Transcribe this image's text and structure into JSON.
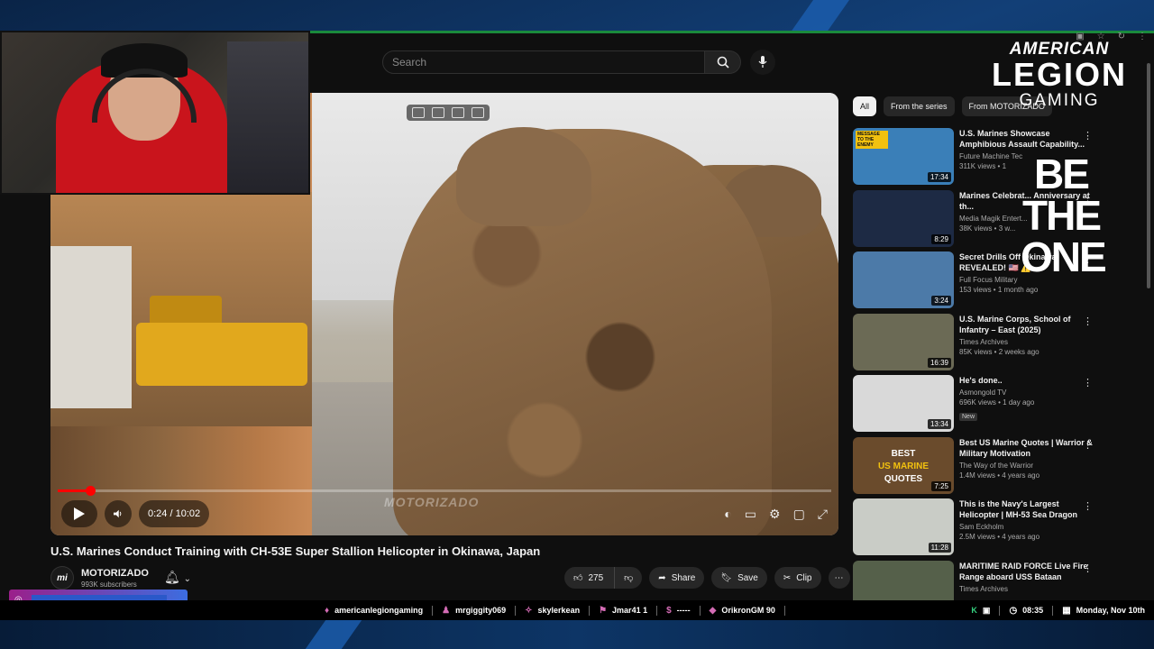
{
  "search": {
    "placeholder": "Search"
  },
  "video": {
    "title": "U.S. Marines Conduct Training with CH-53E Super Stallion Helicopter in Okinawa, Japan",
    "time": "0:24 / 10:02",
    "progress_fraction": 0.0418,
    "watermark": "MOTORIZADO"
  },
  "channel": {
    "name": "MOTORIZADO",
    "subscribers": "993K subscribers",
    "logo": "mi"
  },
  "actions": {
    "likes": "275",
    "share": "Share",
    "save": "Save",
    "clip": "Clip"
  },
  "chips": [
    "All",
    "From the series",
    "From MOTORIZADO"
  ],
  "recommendations": [
    {
      "title": "U.S. Marines Showcase Amphibious Assault Capability...",
      "channel": "Future Machine Tec",
      "meta": "311K views • 1",
      "duration": "17:34",
      "tag": "MESSAGE TO THE ENEMY",
      "thumb_color": "#3a7fb8"
    },
    {
      "title": "Marines Celebrat... Anniversary at th...",
      "channel": "Media Magik Entert...",
      "meta": "38K views • 3 w...",
      "duration": "8:29",
      "thumb_color": "#1d2a44"
    },
    {
      "title": "Secret Drills Off Okinawa REVEALED! 🇺🇸 ⚠️",
      "channel": "Full Focus Military",
      "meta": "153 views • 1 month ago",
      "duration": "3:24",
      "thumb_color": "#4c7aa8"
    },
    {
      "title": "U.S. Marine Corps, School of Infantry – East (2025)",
      "channel": "Times Archives",
      "meta": "85K views • 2 weeks ago",
      "duration": "16:39",
      "thumb_color": "#6b6a55"
    },
    {
      "title": "He's done..",
      "channel": "Asmongold TV",
      "meta": "696K views • 1 day ago",
      "badge": "New",
      "duration": "13:34",
      "thumb_color": "#d9d9d9"
    },
    {
      "title": "Best US Marine Quotes | Warrior & Military Motivation",
      "channel": "The Way of the Warrior",
      "meta": "1.4M views • 4 years ago",
      "duration": "7:25",
      "thumb_line1": "BEST",
      "thumb_line2": "US MARINE",
      "thumb_line3": "QUOTES",
      "thumb_color": "#6a4b2c"
    },
    {
      "title": "This is the Navy's Largest Helicopter | MH-53 Sea Dragon",
      "channel": "Sam Eckholm",
      "meta": "2.5M views • 4 years ago",
      "duration": "11:28",
      "thumb_color": "#c9ccc6"
    },
    {
      "title": "MARITIME RAID FORCE Live Fire Range aboard USS Bataan",
      "channel": "Times Archives",
      "meta": "",
      "duration": "",
      "thumb_color": "#55604a"
    }
  ],
  "branding": {
    "line1": "AMERICAN",
    "line2": "LEGION",
    "line3": "GAMING",
    "slogan": "BE THE ONE"
  },
  "stream_bar": {
    "items": [
      {
        "icon": "community-icon",
        "label": "americanlegiongaming"
      },
      {
        "icon": "follower-icon",
        "label": "mrgiggity069"
      },
      {
        "icon": "subscriber-icon",
        "label": "skylerkean"
      },
      {
        "icon": "raid-icon",
        "label": "Jmar41 1"
      },
      {
        "icon": "donation-icon",
        "label": "-----"
      },
      {
        "icon": "bits-icon",
        "label": "OrikronGM 90"
      }
    ],
    "time": "08:35",
    "date": "Monday, Nov 10th"
  },
  "colors": {
    "accent_red": "#ff0000",
    "frame_green": "#1a8a3c",
    "bar_purple": "#d46cb5"
  }
}
